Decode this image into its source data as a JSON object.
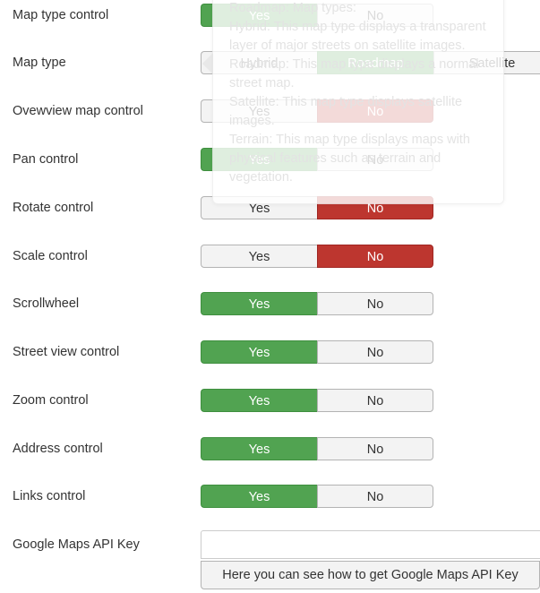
{
  "fields": [
    {
      "label": "Map type control",
      "type": "toggle",
      "options": [
        "Yes",
        "No"
      ],
      "selected": "Yes"
    },
    {
      "label": "Map type",
      "type": "radio",
      "options": [
        "Hybrid",
        "Roadmap",
        "Satellite"
      ],
      "selected": "Roadmap"
    },
    {
      "label": "Ovewview map control",
      "type": "toggle",
      "options": [
        "Yes",
        "No"
      ],
      "selected": "No"
    },
    {
      "label": "Pan control",
      "type": "toggle",
      "options": [
        "Yes",
        "No"
      ],
      "selected": "Yes"
    },
    {
      "label": "Rotate control",
      "type": "toggle",
      "options": [
        "Yes",
        "No"
      ],
      "selected": "No"
    },
    {
      "label": "Scale control",
      "type": "toggle",
      "options": [
        "Yes",
        "No"
      ],
      "selected": "No"
    },
    {
      "label": "Scrollwheel",
      "type": "toggle",
      "options": [
        "Yes",
        "No"
      ],
      "selected": "Yes"
    },
    {
      "label": "Street view control",
      "type": "toggle",
      "options": [
        "Yes",
        "No"
      ],
      "selected": "Yes"
    },
    {
      "label": "Zoom control",
      "type": "toggle",
      "options": [
        "Yes",
        "No"
      ],
      "selected": "Yes"
    },
    {
      "label": "Address control",
      "type": "toggle",
      "options": [
        "Yes",
        "No"
      ],
      "selected": "Yes"
    },
    {
      "label": "Links control",
      "type": "toggle",
      "options": [
        "Yes",
        "No"
      ],
      "selected": "Yes"
    }
  ],
  "api_key": {
    "label": "Google Maps API Key",
    "value": "",
    "help_button": "Here you can see how to get Google Maps API Key"
  },
  "tooltip": {
    "lines": [
      "Roadmap: Map types:",
      "Hybrid: This map type displays a transparent layer of major streets on satellite images.",
      "Roadmap: This map type displays a normal street map.",
      "Satellite: This map type displays satellite images.",
      "Terrain: This map type displays maps with physical features such as terrain and vegetation."
    ]
  },
  "colors": {
    "yes_active": "#51a351",
    "no_active": "#bd362f",
    "inactive": "#f3f3f3"
  }
}
